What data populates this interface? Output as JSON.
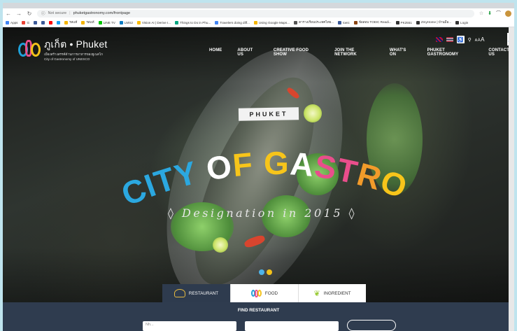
{
  "browser": {
    "address": {
      "security": "Not secure",
      "url": "phuketgastronomy.com/frontpage"
    },
    "bookmarks": [
      {
        "label": "Apps",
        "color": "#4285f4"
      },
      {
        "label": "G",
        "color": "#ea4335"
      },
      {
        "label": "",
        "color": "#3b5998"
      },
      {
        "label": "",
        "color": "#3b5998"
      },
      {
        "label": "",
        "color": "#ff0000"
      },
      {
        "label": "",
        "color": "#1da1f2"
      },
      {
        "label": "รสแท้",
        "color": "#f4b400"
      },
      {
        "label": "รสแท้",
        "color": "#f4b400"
      },
      {
        "label": "LINE TV",
        "color": "#00c300"
      },
      {
        "label": "LMS2",
        "color": "#0b7bc1"
      },
      {
        "label": "Vision AI | Derive I...",
        "color": "#fbbc05"
      },
      {
        "label": "Things to Do in Phu...",
        "color": "#00a680"
      },
      {
        "label": "Travelers doing diff...",
        "color": "#4285f4"
      },
      {
        "label": "Using Google Maps...",
        "color": "#f4b400"
      },
      {
        "label": "ตารางเรียนประเทศไทย...",
        "color": "#555555"
      },
      {
        "label": "toeic",
        "color": "#3b5998"
      },
      {
        "label": "ข้อสอบ TOEIC Readi...",
        "color": "#8b4513"
      },
      {
        "label": "PK2551",
        "color": "#333333"
      },
      {
        "label": "ZmyHome | บ้านมือ...",
        "color": "#333333"
      },
      {
        "label": "Login",
        "color": "#333333"
      }
    ]
  },
  "site": {
    "logo": {
      "name": "ภูเก็ต • Phuket",
      "line1": "เมืองสร้างสรรค์ด้านการอาหารของยูเนสโก",
      "line2": "City of Gastronomy of UNESCO"
    },
    "menu": [
      "HOME",
      "ABOUT US",
      "CREATIVE FOOD SHOW",
      "JOIN THE NETWORK",
      "WHAT'S ON",
      "PHUKET GASTRONOMY",
      "CONTACT US"
    ],
    "font_size_label": "AAA",
    "hero": {
      "tag": "PHUKET",
      "headline": "CITY OF GASTRONOMY",
      "subline": "Designation in 2015",
      "headline_colors": [
        "#2ba8e0",
        "#2ba8e0",
        "#2ba8e0",
        "#2ba8e0",
        "#ffffff",
        "#f7c51a",
        "#f7c51a",
        "#ffffff",
        "#e94e8c",
        "#e94e8c",
        "#f29b2a",
        "#f7c51a",
        "#8cc63f",
        "#2ba8e0",
        "#e94e8c",
        "#8cc63f",
        "#2ba8e0",
        "#f7c51a"
      ],
      "slider_dots": [
        "#4fb3e8",
        "#f4c21a"
      ]
    },
    "tabs": [
      {
        "label": "RESTAURANT",
        "active": true
      },
      {
        "label": "FOOD",
        "active": false
      },
      {
        "label": "INGREDIENT",
        "active": false
      }
    ],
    "find": {
      "title": "FIND RESTAURANT",
      "field1_placeholder": "Nh...",
      "field2_placeholder": ""
    }
  }
}
